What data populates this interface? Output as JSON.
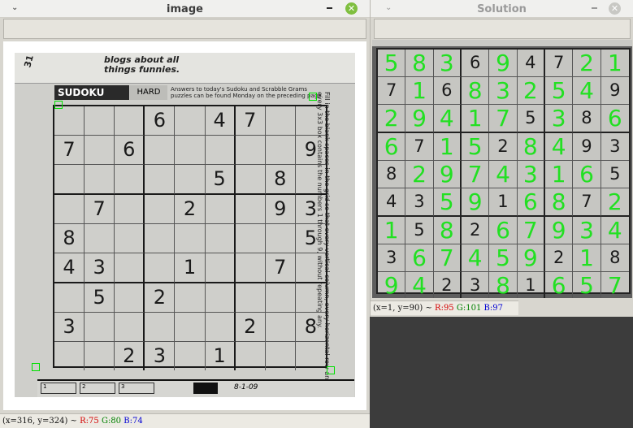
{
  "windows": {
    "image": {
      "title": "image",
      "status": {
        "coords": "(x=316, y=324) ~",
        "r": "R:75",
        "g": "G:80",
        "b": "B:74"
      }
    },
    "solution": {
      "title": "Solution",
      "status": {
        "coords": "(x=1, y=90) ~",
        "r": "R:95",
        "g": "G:101",
        "b": "B:97"
      }
    }
  },
  "newspaper": {
    "corner_number": "31",
    "cartoon_caption": "blogs about all things funnies.",
    "header": "SUDOKU",
    "difficulty": "HARD",
    "answers_note": "Answers to today's Sudoku and Scrabble Grams puzzles can be found Monday on the preceding page.",
    "instructions": "Fill in the blank spaces in the grid so that every vertical column, every horizontal row and every 3x3 box contains the numbers 1 through 9, without repeating any.",
    "date": "8-1-09",
    "strip_numbers": [
      "1",
      "2",
      "3"
    ]
  },
  "sudoku": {
    "rows": [
      [
        "",
        "",
        "",
        "6",
        "",
        "4",
        "7",
        "",
        ""
      ],
      [
        "7",
        "",
        "6",
        "",
        "",
        "",
        "",
        "",
        "9"
      ],
      [
        "",
        "",
        "",
        "",
        "",
        "5",
        "",
        "8",
        ""
      ],
      [
        "",
        "7",
        "",
        "",
        "2",
        "",
        "",
        "9",
        "3"
      ],
      [
        "8",
        "",
        "",
        "",
        "",
        "",
        "",
        "",
        "5"
      ],
      [
        "4",
        "3",
        "",
        "",
        "1",
        "",
        "",
        "7",
        ""
      ],
      [
        "",
        "5",
        "",
        "2",
        "",
        "",
        "",
        "",
        ""
      ],
      [
        "3",
        "",
        "",
        "",
        "",
        "",
        "2",
        "",
        "8"
      ],
      [
        "",
        "",
        "2",
        "3",
        "",
        "1",
        "",
        "",
        ""
      ]
    ]
  },
  "solution": {
    "rows": [
      [
        "5",
        "8",
        "3",
        "6",
        "9",
        "4",
        "7",
        "2",
        "1"
      ],
      [
        "7",
        "1",
        "6",
        "8",
        "3",
        "2",
        "5",
        "4",
        "9"
      ],
      [
        "2",
        "9",
        "4",
        "1",
        "7",
        "5",
        "3",
        "8",
        "6"
      ],
      [
        "6",
        "7",
        "1",
        "5",
        "2",
        "8",
        "4",
        "9",
        "3"
      ],
      [
        "8",
        "2",
        "9",
        "7",
        "4",
        "3",
        "1",
        "6",
        "5"
      ],
      [
        "4",
        "3",
        "5",
        "9",
        "1",
        "6",
        "8",
        "7",
        "2"
      ],
      [
        "1",
        "5",
        "8",
        "2",
        "6",
        "7",
        "9",
        "3",
        "4"
      ],
      [
        "3",
        "6",
        "7",
        "4",
        "5",
        "9",
        "2",
        "1",
        "8"
      ],
      [
        "9",
        "4",
        "2",
        "3",
        "8",
        "1",
        "6",
        "5",
        "7"
      ]
    ]
  },
  "colors": {
    "solved_digit": "#22e022",
    "corner_marker": "#00e000",
    "close_button": "#7fbf3f",
    "close_button_inactive": "#c8c8c4",
    "status_r": "#d40000",
    "status_g": "#008000",
    "status_b": "#0000d4"
  },
  "icons": [
    "chevron-down-icon",
    "minimize-icon",
    "close-icon"
  ]
}
